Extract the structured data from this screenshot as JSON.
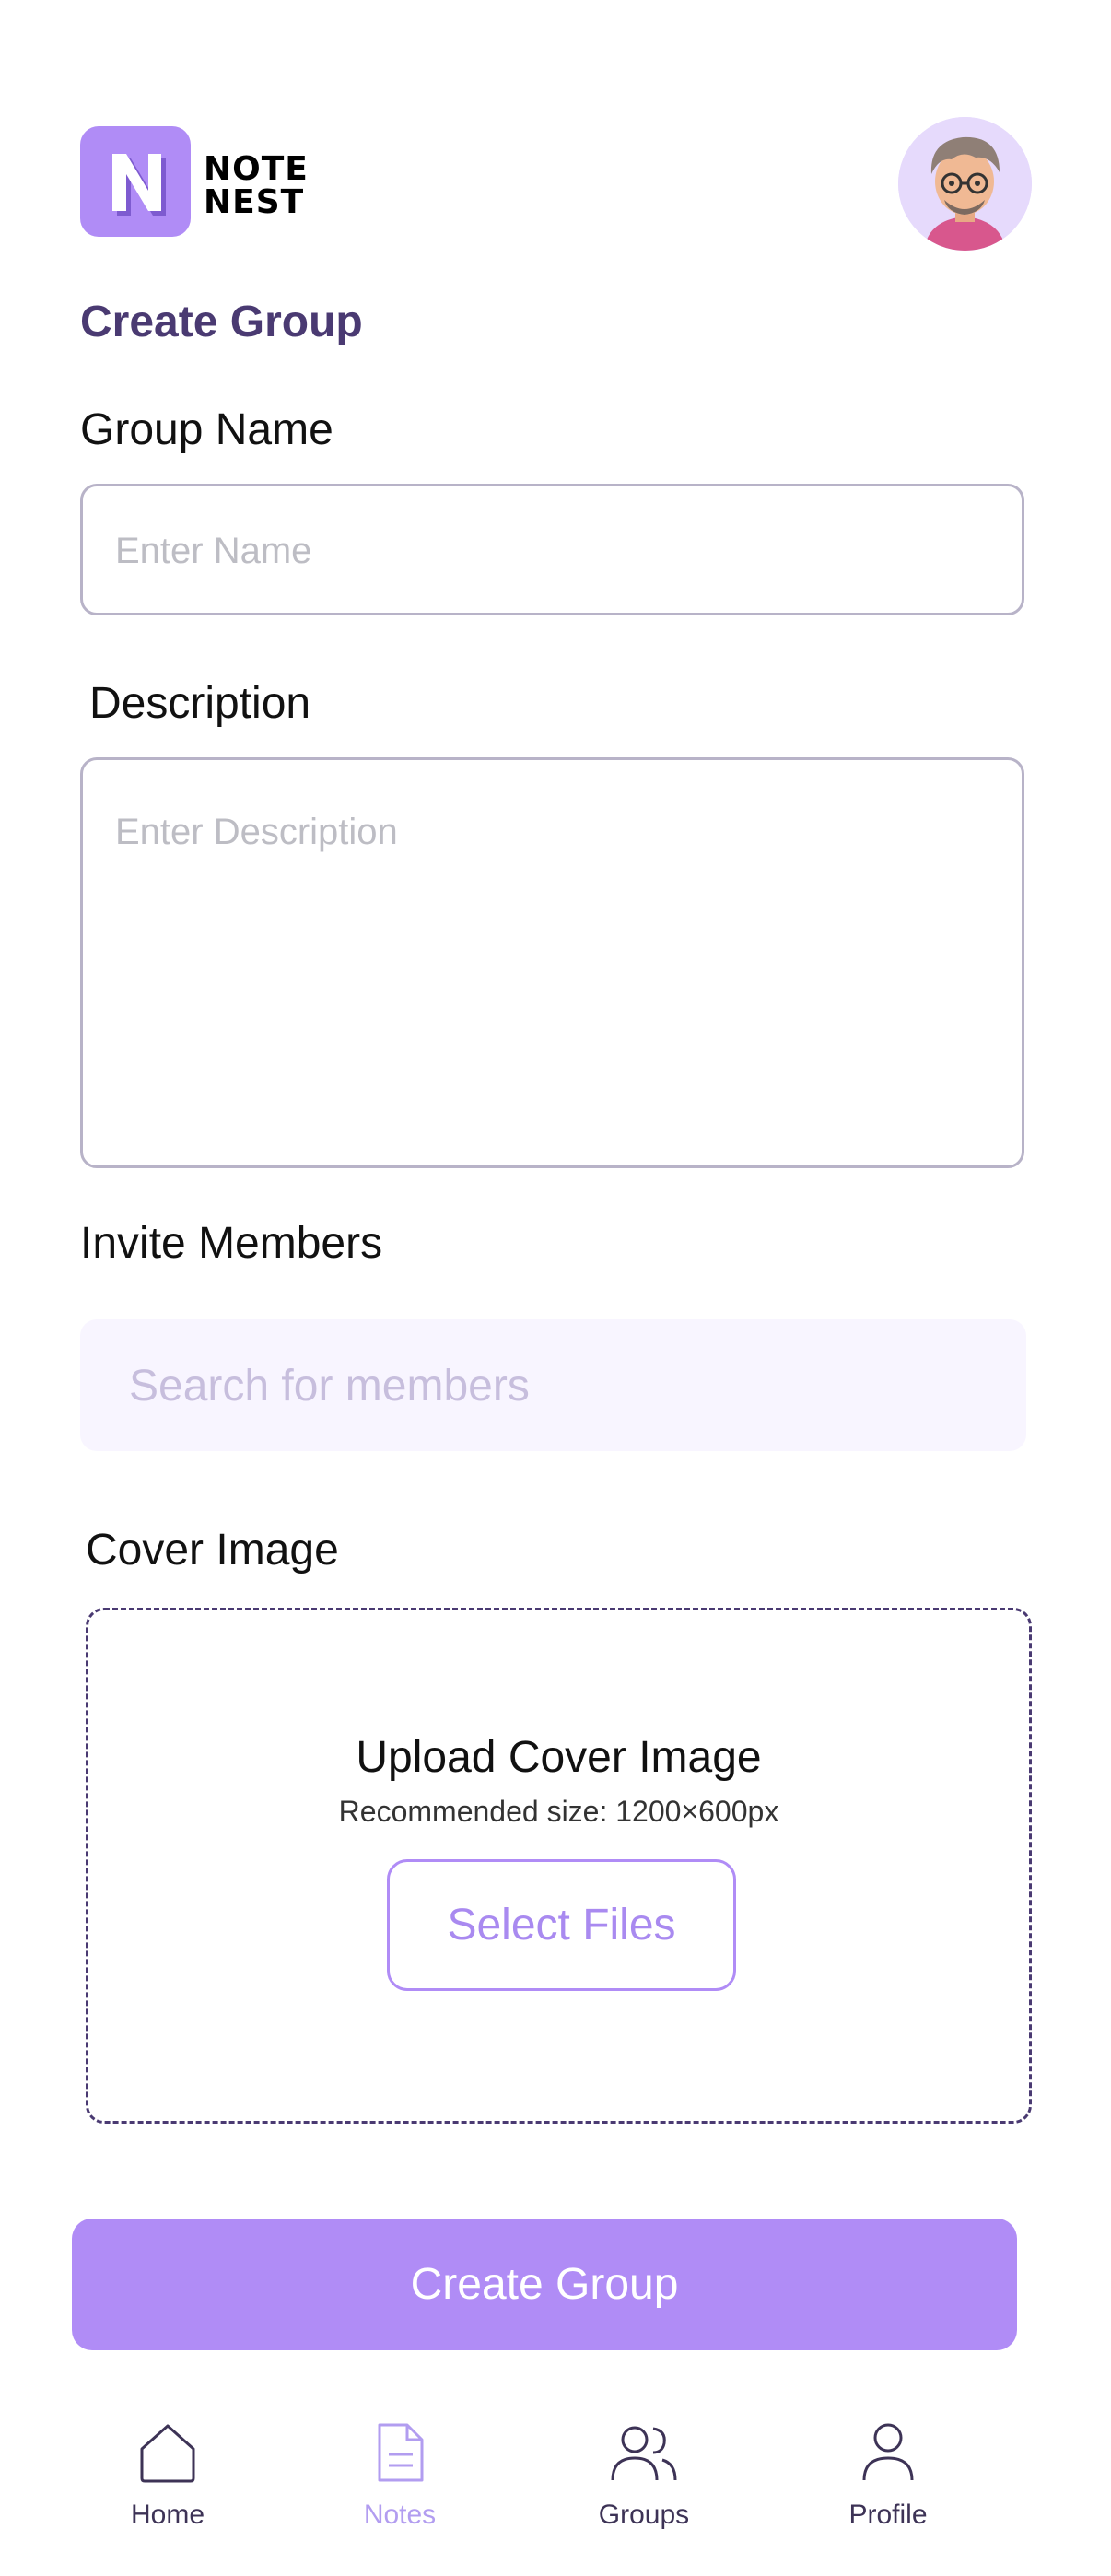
{
  "app": {
    "logo_line1": "NOTE",
    "logo_line2": "NEST",
    "logo_letter": "N"
  },
  "page": {
    "title": "Create Group"
  },
  "form": {
    "group_name": {
      "label": "Group Name",
      "placeholder": "Enter Name"
    },
    "description": {
      "label": "Description",
      "placeholder": "Enter Description"
    },
    "invite": {
      "label": "Invite Members",
      "placeholder": "Search for members"
    },
    "cover": {
      "label": "Cover Image",
      "upload_title": "Upload Cover Image",
      "upload_hint": "Recommended size: 1200×600px",
      "select_label": "Select Files"
    },
    "submit_label": "Create Group"
  },
  "bottom_nav": [
    {
      "label": "Home",
      "icon": "home-icon",
      "active": false
    },
    {
      "label": "Notes",
      "icon": "notes-icon",
      "active": true
    },
    {
      "label": "Groups",
      "icon": "groups-icon",
      "active": false
    },
    {
      "label": "Profile",
      "icon": "profile-icon",
      "active": false
    }
  ],
  "colors": {
    "accent": "#b08cf6",
    "title": "#4a3a72",
    "nav_inactive": "#3d3356",
    "nav_active": "#b29df0"
  }
}
